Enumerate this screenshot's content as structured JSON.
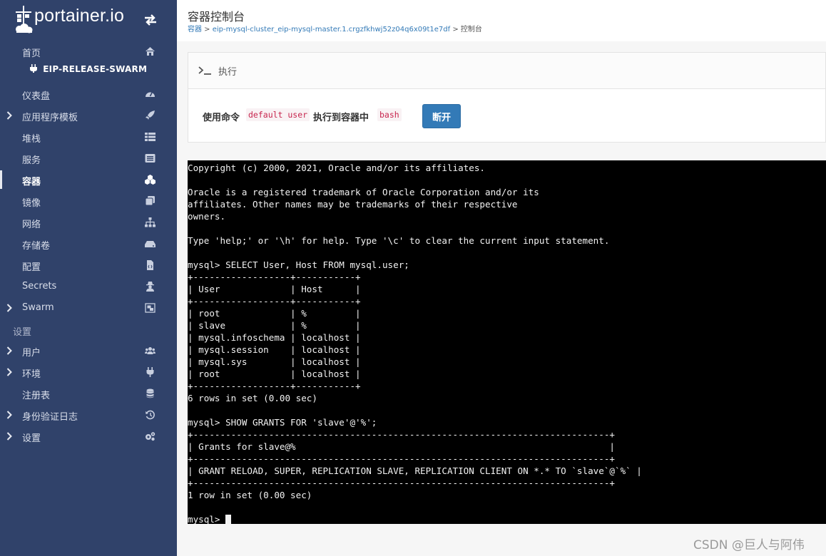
{
  "brand": {
    "logo_text": "portainer.io"
  },
  "sidebar": {
    "endpoint_name": "EIP-RELEASE-SWARM",
    "settings_section_label": "设置",
    "items": [
      {
        "label": "首页",
        "icon": "home-icon",
        "has_chevron": false
      },
      {
        "label": "仪表盘",
        "icon": "dashboard-icon",
        "has_chevron": false
      },
      {
        "label": "应用程序模板",
        "icon": "rocket-icon",
        "has_chevron": true
      },
      {
        "label": "堆栈",
        "icon": "th-list-icon",
        "has_chevron": false
      },
      {
        "label": "服务",
        "icon": "list-alt-icon",
        "has_chevron": false
      },
      {
        "label": "容器",
        "icon": "cubes-icon",
        "has_chevron": false,
        "active": true
      },
      {
        "label": "镜像",
        "icon": "clone-icon",
        "has_chevron": false
      },
      {
        "label": "网络",
        "icon": "sitemap-icon",
        "has_chevron": false
      },
      {
        "label": "存储卷",
        "icon": "hdd-icon",
        "has_chevron": false
      },
      {
        "label": "配置",
        "icon": "file-code-icon",
        "has_chevron": false
      },
      {
        "label": "Secrets",
        "icon": "user-secret-icon",
        "has_chevron": false
      },
      {
        "label": "Swarm",
        "icon": "object-group-icon",
        "has_chevron": true
      },
      {
        "label": "用户",
        "icon": "users-icon",
        "has_chevron": true
      },
      {
        "label": "环境",
        "icon": "plug-icon",
        "has_chevron": true
      },
      {
        "label": "注册表",
        "icon": "database-icon",
        "has_chevron": false
      },
      {
        "label": "身份验证日志",
        "icon": "history-icon",
        "has_chevron": true
      },
      {
        "label": "设置",
        "icon": "cogs-icon",
        "has_chevron": true
      }
    ]
  },
  "header": {
    "title": "容器控制台",
    "breadcrumb": {
      "root": "容器",
      "sep": " > ",
      "container": "eip-mysql-cluster_eip-mysql-master.1.crgzfkhwj52z04q6x09t1e7df",
      "current": "控制台"
    }
  },
  "exec_panel": {
    "title": "执行",
    "use_command_label": "使用命令",
    "user_code": "default user",
    "exec_in_label": "执行到容器中",
    "shell_code": "bash",
    "disconnect_label": "断开"
  },
  "terminal": {
    "text": "Copyright (c) 2000, 2021, Oracle and/or its affiliates.\n\nOracle is a registered trademark of Oracle Corporation and/or its\naffiliates. Other names may be trademarks of their respective\nowners.\n\nType 'help;' or '\\h' for help. Type '\\c' to clear the current input statement.\n\nmysql> SELECT User, Host FROM mysql.user;\n+------------------+-----------+\n| User             | Host      |\n+------------------+-----------+\n| root             | %         |\n| slave            | %         |\n| mysql.infoschema | localhost |\n| mysql.session    | localhost |\n| mysql.sys        | localhost |\n| root             | localhost |\n+------------------+-----------+\n6 rows in set (0.00 sec)\n\nmysql> SHOW GRANTS FOR 'slave'@'%';\n+-----------------------------------------------------------------------------+\n| Grants for slave@%                                                          |\n+-----------------------------------------------------------------------------+\n| GRANT RELOAD, SUPER, REPLICATION SLAVE, REPLICATION CLIENT ON *.* TO `slave`@`%` |\n+-----------------------------------------------------------------------------+\n1 row in set (0.00 sec)\n\n",
    "prompt": "mysql> "
  },
  "watermark": "CSDN @巨人与阿伟"
}
